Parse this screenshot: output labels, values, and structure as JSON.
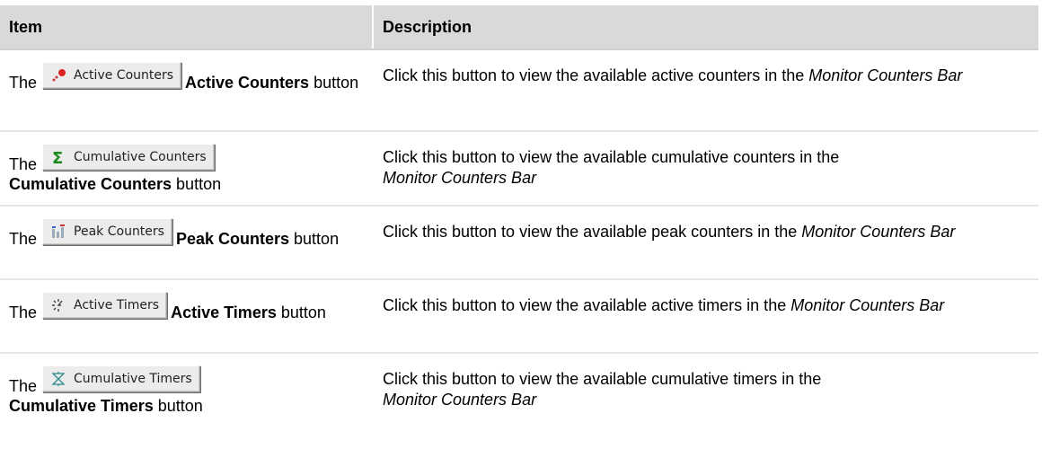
{
  "header": {
    "col_item": "Item",
    "col_description": "Description"
  },
  "rows": [
    {
      "prefix": "The",
      "button_label": "Active Counters",
      "icon": "active-counters-icon",
      "name": "Active Counters",
      "suffix": "button",
      "description": "Click this button to view the available active counters in the",
      "description_italic": "Monitor Counters Bar"
    },
    {
      "prefix": "The",
      "button_label": "Cumulative Counters",
      "icon": "sigma-icon",
      "name": "Cumulative Counters",
      "suffix": "button",
      "description": "Click this button to view the available cumulative counters in the",
      "description_italic": "Monitor Counters Bar"
    },
    {
      "prefix": "The",
      "button_label": "Peak Counters",
      "icon": "peak-counters-icon",
      "name": "Peak Counters",
      "suffix": "button",
      "description": "Click this button to view the available peak counters in the",
      "description_italic": "Monitor Counters Bar"
    },
    {
      "prefix": "The",
      "button_label": "Active Timers",
      "icon": "active-timers-icon",
      "name": "Active Timers",
      "suffix": "button",
      "description": "Click this button to view the available active timers in the",
      "description_italic": "Monitor Counters Bar"
    },
    {
      "prefix": "The",
      "button_label": "Cumulative Timers",
      "icon": "cumulative-timers-icon",
      "name": "Cumulative Timers",
      "suffix": "button",
      "description": "Click this button to view the available cumulative timers in the",
      "description_italic": "Monitor Counters Bar"
    }
  ]
}
